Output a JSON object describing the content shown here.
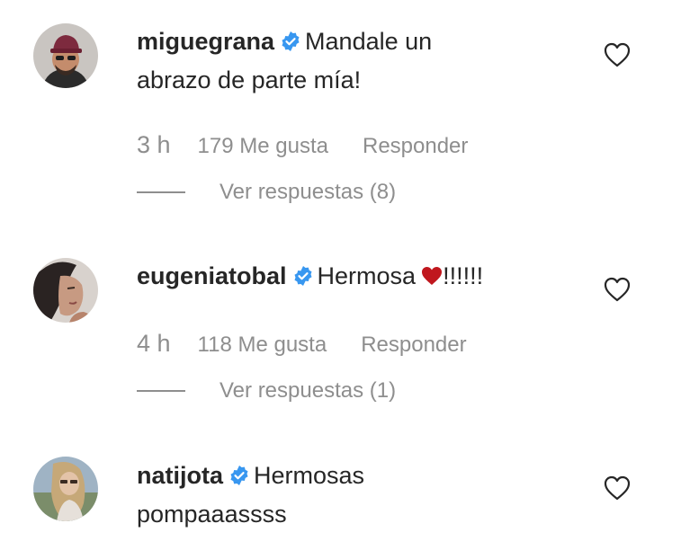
{
  "comments": [
    {
      "username": "miguegrana",
      "text_line1": "Mandale un",
      "text_line2": "abrazo de parte mía!",
      "time": "3 h",
      "likes": "179 Me gusta",
      "reply_label": "Responder",
      "view_replies": "Ver respuestas (8)"
    },
    {
      "username": "eugeniatobal",
      "text": "Hermosa",
      "text_suffix": "!!!!!!",
      "time": "4 h",
      "likes": "118 Me gusta",
      "reply_label": "Responder",
      "view_replies": "Ver respuestas (1)"
    },
    {
      "username": "natijota",
      "text_line1": "Hermosas",
      "text_line2": "pompaaassss"
    }
  ],
  "icons": {
    "verified": "verified-badge-icon",
    "like": "heart-outline-icon",
    "emoji": "red-heart-emoji"
  },
  "colors": {
    "verified": "#3897f0",
    "meta_text": "#8e8e8e",
    "emoji_heart": "#c0171e"
  }
}
